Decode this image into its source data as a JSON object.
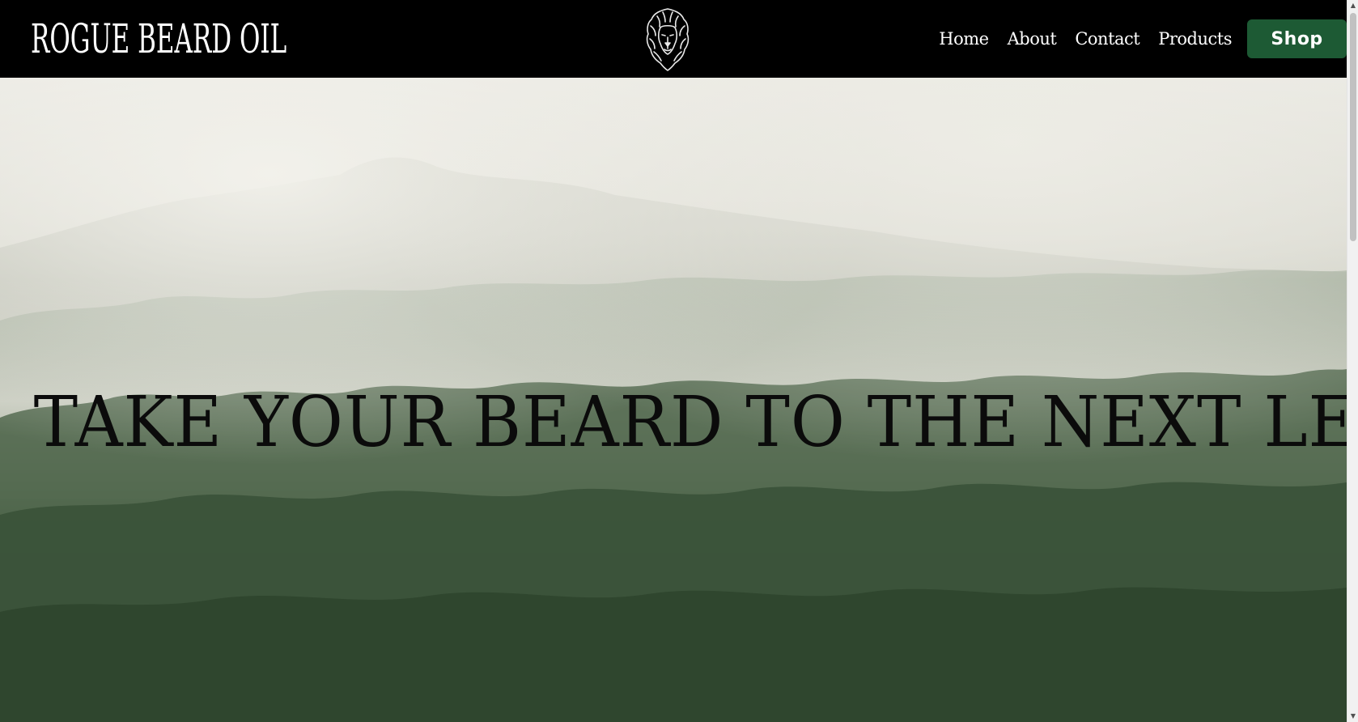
{
  "header": {
    "brand": "ROGUE BEARD OIL",
    "logo_icon": "lion-head-icon",
    "nav": [
      {
        "label": "Home"
      },
      {
        "label": "About"
      },
      {
        "label": "Contact"
      },
      {
        "label": "Products"
      }
    ],
    "shop_label": "Shop"
  },
  "hero": {
    "title": "TAKE YOUR BEARD TO THE NEXT LEVEL",
    "background": "misty-forest-mountain-image"
  },
  "colors": {
    "header_bg": "#000000",
    "shop_button": "#1d5a34",
    "nav_text": "#ffffff",
    "hero_text": "#0b0b0b"
  }
}
